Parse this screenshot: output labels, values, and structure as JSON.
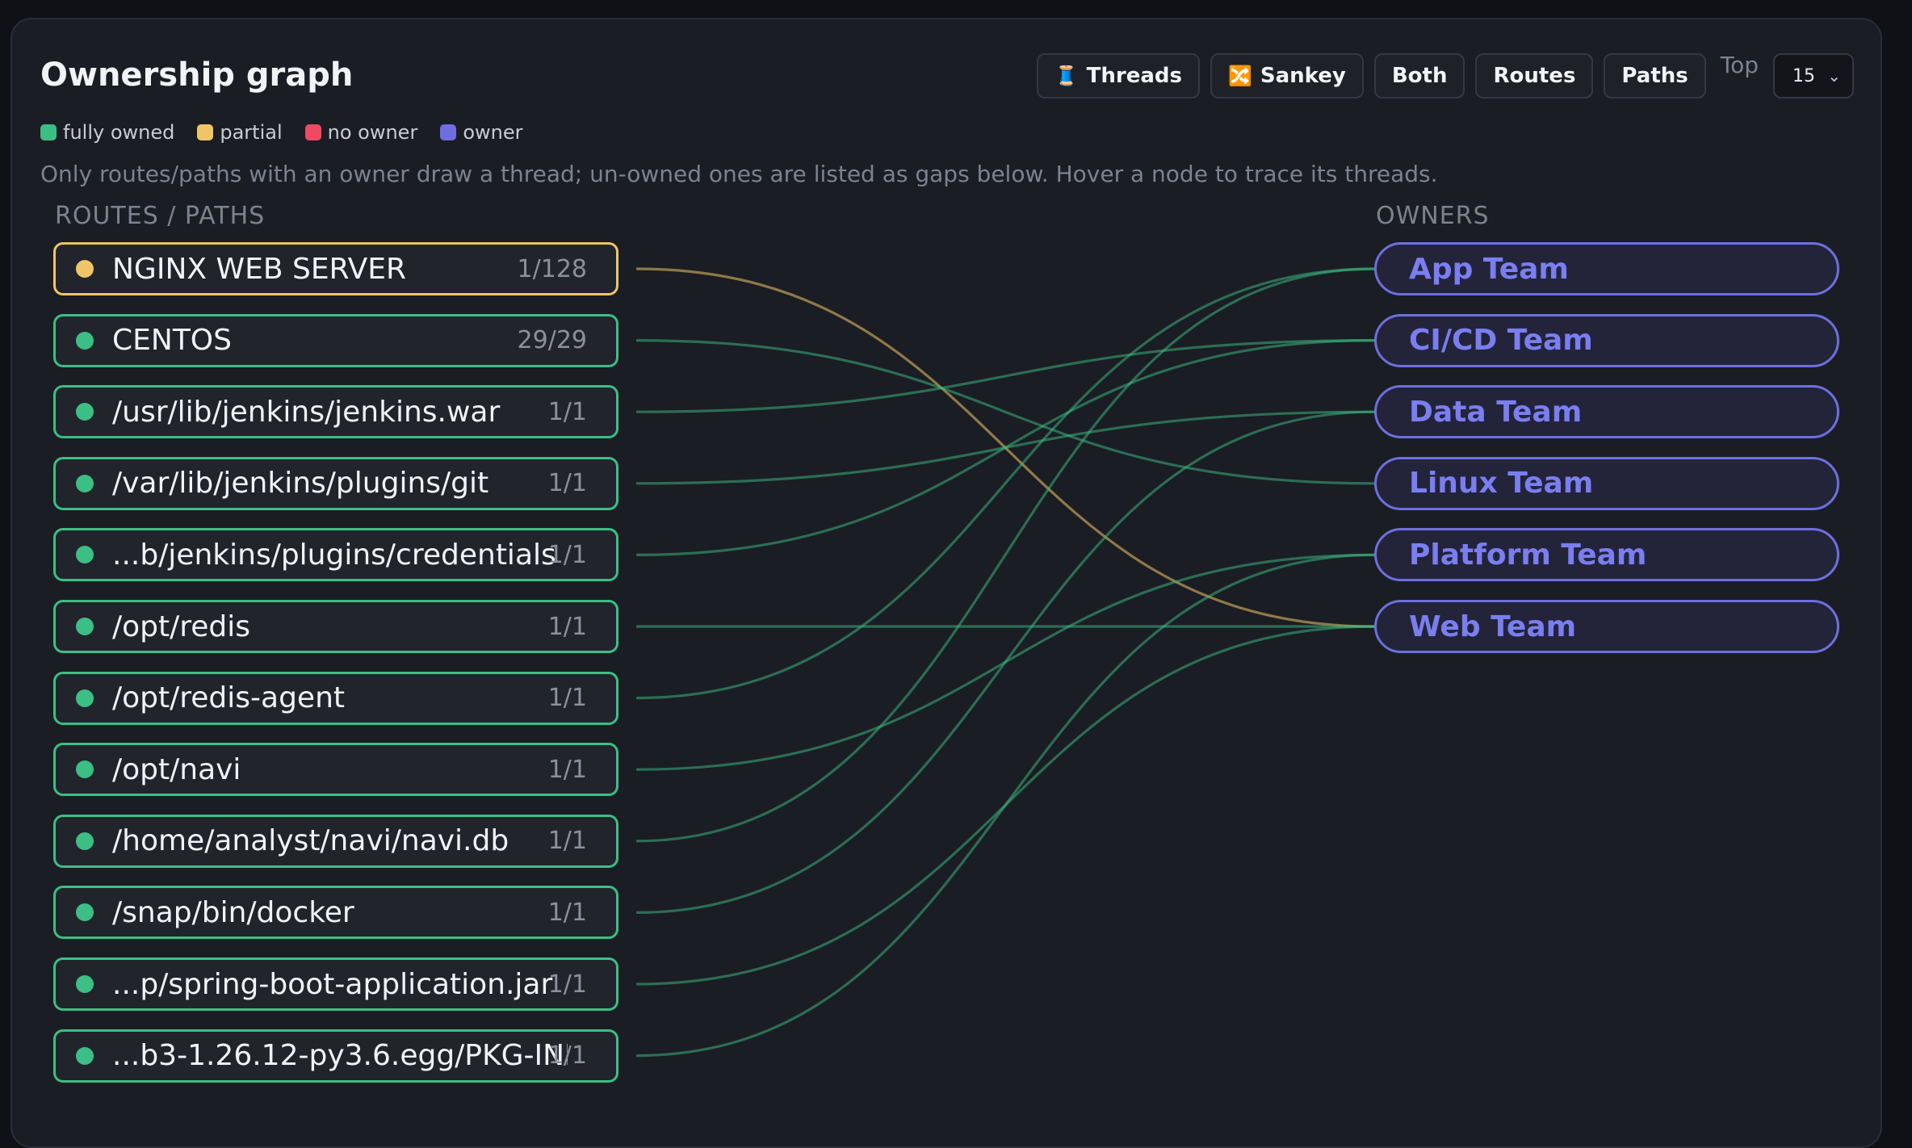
{
  "header": {
    "title": "Ownership graph"
  },
  "legend": [
    {
      "label": "fully owned",
      "color": "#3bbf84"
    },
    {
      "label": "partial",
      "color": "#efc566"
    },
    {
      "label": "no owner",
      "color": "#ef4a62"
    },
    {
      "label": "owner",
      "color": "#6e6ee0"
    }
  ],
  "description": "Only routes/paths with an owner draw a thread; un-owned ones are listed as gaps below. Hover a node to trace its threads.",
  "toolbar": {
    "threads_label": "Threads",
    "sankey_label": "Sankey",
    "both_label": "Both",
    "routes_label": "Routes",
    "paths_label": "Paths",
    "top_label": "Top",
    "top_value": "15"
  },
  "columns": {
    "routes_header": "ROUTES / PATHS",
    "owners_header": "OWNERS"
  },
  "routes": [
    {
      "label": "NGINX WEB SERVER",
      "count": "1/128",
      "status": "partial"
    },
    {
      "label": "CENTOS",
      "count": "29/29",
      "status": "full"
    },
    {
      "label": "/usr/lib/jenkins/jenkins.war",
      "count": "1/1",
      "status": "full"
    },
    {
      "label": "/var/lib/jenkins/plugins/git",
      "count": "1/1",
      "status": "full"
    },
    {
      "label": "...b/jenkins/plugins/credentials",
      "count": "1/1",
      "status": "full"
    },
    {
      "label": "/opt/redis",
      "count": "1/1",
      "status": "full"
    },
    {
      "label": "/opt/redis-agent",
      "count": "1/1",
      "status": "full"
    },
    {
      "label": "/opt/navi",
      "count": "1/1",
      "status": "full"
    },
    {
      "label": "/home/analyst/navi/navi.db",
      "count": "1/1",
      "status": "full"
    },
    {
      "label": "/snap/bin/docker",
      "count": "1/1",
      "status": "full"
    },
    {
      "label": "...p/spring-boot-application.jar",
      "count": "1/1",
      "status": "full"
    },
    {
      "label": "...b3-1.26.12-py3.6.egg/PKG-INFO",
      "count": "1/1",
      "status": "full"
    }
  ],
  "owners": [
    {
      "label": "App Team"
    },
    {
      "label": "CI/CD Team"
    },
    {
      "label": "Data Team"
    },
    {
      "label": "Linux Team"
    },
    {
      "label": "Platform Team"
    },
    {
      "label": "Web Team"
    }
  ],
  "links": [
    {
      "route": 0,
      "owner": 5,
      "status": "partial"
    },
    {
      "route": 1,
      "owner": 3,
      "status": "full"
    },
    {
      "route": 2,
      "owner": 1,
      "status": "full"
    },
    {
      "route": 3,
      "owner": 2,
      "status": "full"
    },
    {
      "route": 4,
      "owner": 1,
      "status": "full"
    },
    {
      "route": 5,
      "owner": 5,
      "status": "full"
    },
    {
      "route": 6,
      "owner": 0,
      "status": "full"
    },
    {
      "route": 7,
      "owner": 4,
      "status": "full"
    },
    {
      "route": 8,
      "owner": 0,
      "status": "full"
    },
    {
      "route": 9,
      "owner": 2,
      "status": "full"
    },
    {
      "route": 10,
      "owner": 5,
      "status": "full"
    },
    {
      "route": 11,
      "owner": 4,
      "status": "full"
    }
  ],
  "colors": {
    "full": "#3bbf84",
    "partial": "#efc566",
    "owner": "#6e6ee0"
  }
}
